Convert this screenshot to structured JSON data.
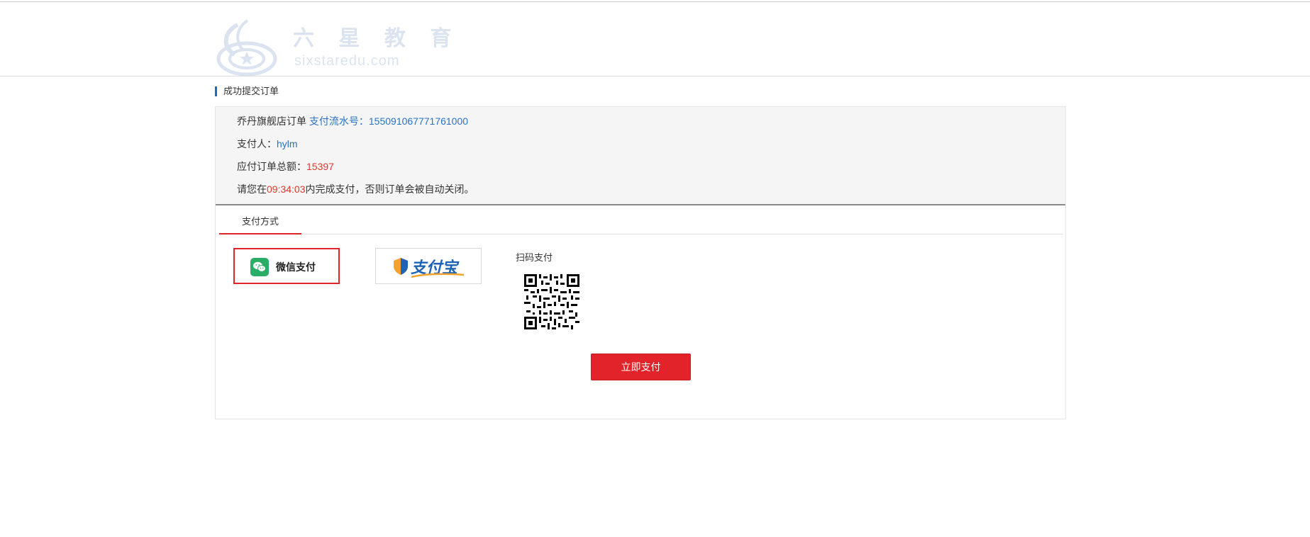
{
  "header": {
    "logo_name": "六 星 教 育",
    "logo_domain": "sixstaredu.com"
  },
  "section_title": "成功提交订单",
  "order": {
    "shop_label": "乔丹旗舰店订单",
    "serial_label": "支付流水号：",
    "serial_value": "155091067771761000",
    "payer_label": "支付人：",
    "payer_value": "hylm",
    "total_label": "应付订单总额：",
    "total_value": "15397",
    "countdown_prefix": "请您在",
    "countdown_value": "09:34:03",
    "countdown_suffix": "内完成支付，否则订单会被自动关闭。"
  },
  "payment": {
    "tab_label": "支付方式",
    "wechat_label": "微信支付",
    "alipay_label": "支付宝",
    "qr_label": "扫码支付",
    "pay_button": "立即支付"
  },
  "colors": {
    "accent_red": "#e2232a",
    "link_blue": "#2a73c4",
    "wechat_green": "#2aae67",
    "alipay_blue": "#1d63b6"
  },
  "icons": [
    "logo-emblem-icon",
    "wechat-icon",
    "alipay-shield-icon",
    "qr-code-icon"
  ]
}
